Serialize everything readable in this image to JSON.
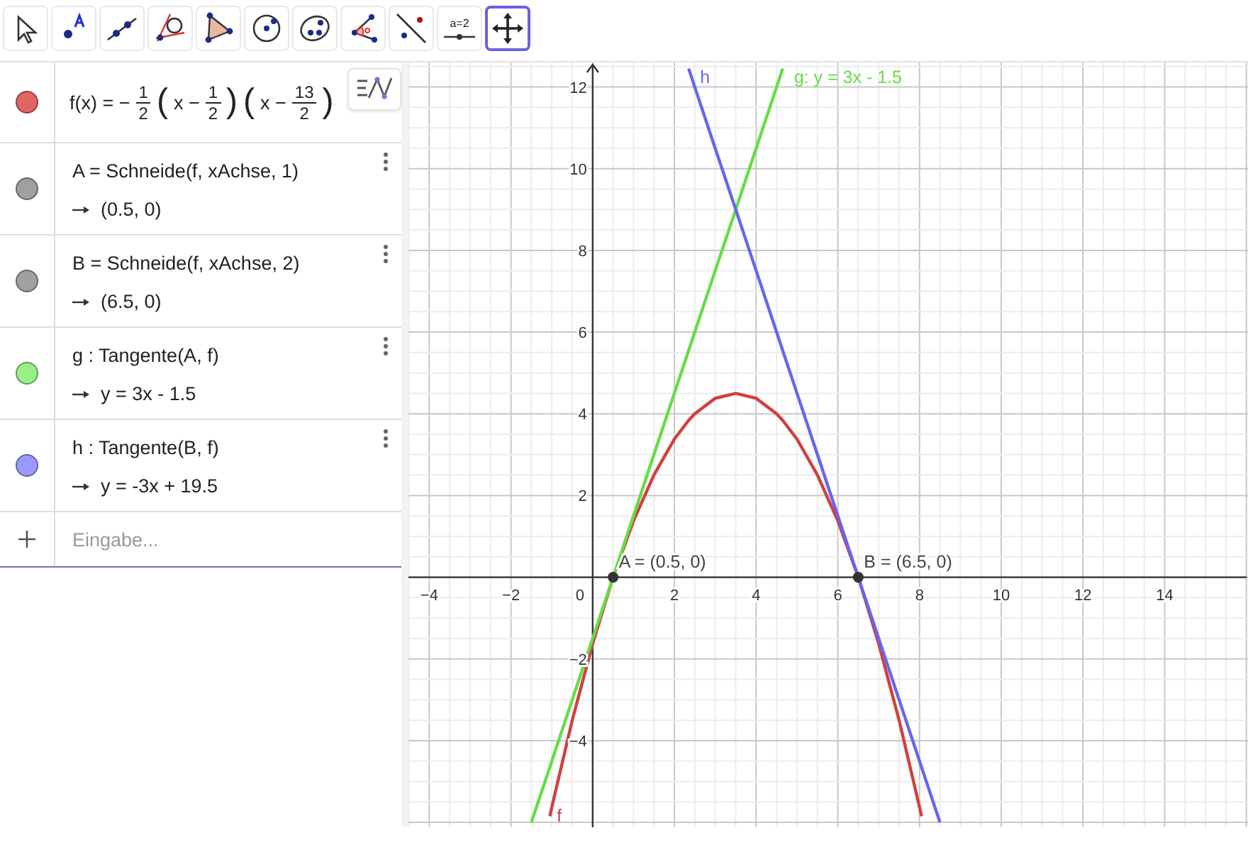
{
  "toolbar": {
    "tools": [
      {
        "kind": "move",
        "selected": false
      },
      {
        "kind": "point",
        "selected": false
      },
      {
        "kind": "line",
        "selected": false
      },
      {
        "kind": "tangent",
        "selected": false
      },
      {
        "kind": "polygon",
        "selected": false
      },
      {
        "kind": "circle",
        "selected": false
      },
      {
        "kind": "ellipse",
        "selected": false
      },
      {
        "kind": "angle",
        "selected": false
      },
      {
        "kind": "reflect",
        "selected": false
      },
      {
        "kind": "slider",
        "selected": false,
        "label": "a=2"
      },
      {
        "kind": "pan",
        "selected": true
      }
    ]
  },
  "algebra": {
    "rows": [
      {
        "kind": "formula",
        "color": "#e06666",
        "tokens": [
          {
            "kind": "text",
            "text": "f(x) = −"
          },
          {
            "kind": "frac",
            "num": "1",
            "den": "2"
          },
          {
            "kind": "paren",
            "text": "("
          },
          {
            "kind": "text",
            "text": "x −"
          },
          {
            "kind": "frac",
            "num": "1",
            "den": "2"
          },
          {
            "kind": "paren",
            "text": ")"
          },
          {
            "kind": "paren",
            "text": "("
          },
          {
            "kind": "text",
            "text": "x −"
          },
          {
            "kind": "frac",
            "num": "13",
            "den": "2"
          },
          {
            "kind": "paren",
            "text": ")"
          }
        ]
      },
      {
        "kind": "definition",
        "color": "#a0a0a0",
        "definition": "A = Schneide(f, xAchse, 1)",
        "value": "(0.5, 0)"
      },
      {
        "kind": "definition",
        "color": "#a0a0a0",
        "definition": "B = Schneide(f, xAchse, 2)",
        "value": "(6.5, 0)"
      },
      {
        "kind": "definition",
        "color": "#99ee88",
        "definition": "g : Tangente(A, f)",
        "value": "y = 3x - 1.5"
      },
      {
        "kind": "definition",
        "color": "#9999ff",
        "definition": "h : Tangente(B, f)",
        "value": "y = -3x + 19.5"
      }
    ],
    "input": {
      "placeholder": "Eingabe..."
    }
  },
  "graphics": {
    "chart_data": {
      "type": "line",
      "grid": true,
      "x": [
        -1.5,
        -1.05,
        -1,
        -0.5,
        0,
        0.5,
        1,
        1.5,
        2,
        2.35,
        2.5,
        3,
        3.5,
        4,
        4.5,
        4.65,
        5,
        5.5,
        6,
        6.5,
        7,
        7.5,
        8,
        8.05,
        8.5
      ],
      "series": [
        {
          "name": "f",
          "color": "#d04040",
          "values": [
            null,
            -5.85,
            -5.63,
            -3.5,
            -1.63,
            0,
            1.38,
            2.5,
            3.38,
            3.84,
            4,
            4.38,
            4.5,
            4.38,
            4,
            3.84,
            3.38,
            2.5,
            1.38,
            0,
            -1.63,
            -3.5,
            -5.63,
            -5.85,
            null
          ]
        },
        {
          "name": "g: y = 3x - 1.5",
          "color": "#66dd44",
          "values": [
            -6,
            -4.65,
            -4.5,
            -3,
            -1.5,
            0,
            1.5,
            3,
            4.5,
            5.55,
            6,
            7.5,
            9,
            10.5,
            12,
            12.45,
            null,
            null,
            null,
            null,
            null,
            null,
            null,
            null,
            null
          ]
        },
        {
          "name": "h",
          "color": "#6666ee",
          "values": [
            null,
            null,
            null,
            null,
            null,
            null,
            null,
            null,
            null,
            12.45,
            12,
            10.5,
            9,
            7.5,
            6,
            5.55,
            4.5,
            3,
            1.5,
            0,
            -1.5,
            -3,
            -4.5,
            -4.65,
            -6
          ]
        }
      ],
      "xlim": [
        -4.51,
        16.04
      ],
      "ylim": [
        -6.12,
        12.6
      ],
      "xticks": [
        {
          "value": -4,
          "label": "−4"
        },
        {
          "value": -2,
          "label": "−2"
        },
        {
          "value": 0,
          "label": "0"
        },
        2,
        4,
        6,
        8,
        10,
        12,
        14
      ],
      "yticks": [
        {
          "value": -4,
          "label": "−4"
        },
        {
          "value": -2,
          "label": "−2"
        },
        2,
        4,
        6,
        8,
        10,
        12
      ],
      "annotations": [
        {
          "text": "A = (0.5, 0)",
          "x": 0.5,
          "y": 0
        },
        {
          "text": "B = (6.5, 0)",
          "x": 6.5,
          "y": 0
        }
      ]
    }
  }
}
